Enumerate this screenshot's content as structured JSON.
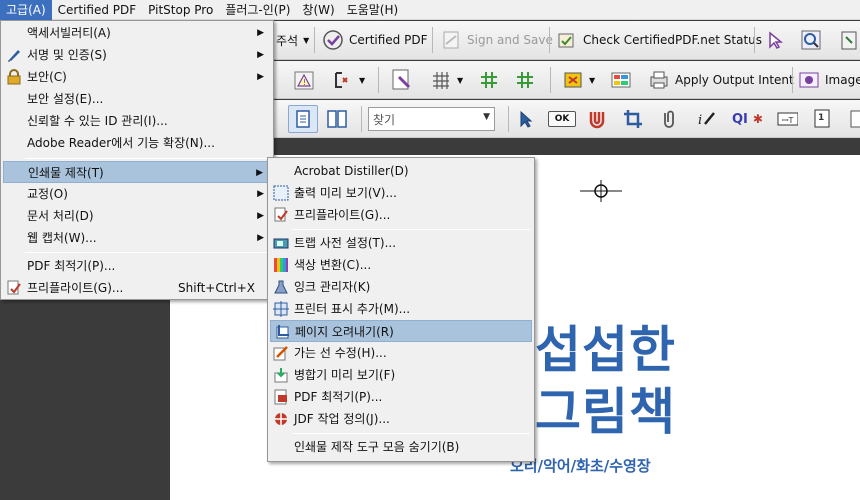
{
  "menubar": {
    "items": [
      "고급(A)",
      "Certified PDF",
      "PitStop Pro",
      "플러그-인(P)",
      "창(W)",
      "도움말(H)"
    ]
  },
  "toolbar1": {
    "partial_label": "주석",
    "certified_pdf": "Certified PDF",
    "sign_and_save": "Sign and Save",
    "check_status": "Check CertifiedPDF.net Status"
  },
  "toolbar2": {
    "apply_output_intent": "Apply Output Intent",
    "image": "Image"
  },
  "toolbar3": {
    "find_placeholder": "찾기",
    "ok_label": "OK",
    "qi_label": "QI"
  },
  "document": {
    "title_line1": "섭섭한",
    "title_line2": "그림책",
    "subtitle": "오리/악어/화초/수영장"
  },
  "menu_advanced": {
    "items": [
      {
        "label": "액세서빌러티(A)",
        "submenu": true
      },
      {
        "label": "서명 및 인증(S)",
        "submenu": true,
        "icon": "pen-icon"
      },
      {
        "label": "보안(C)",
        "submenu": true,
        "icon": "lock-icon"
      },
      {
        "label": "보안 설정(E)..."
      },
      {
        "label": "신뢰할 수 있는 ID 관리(I)..."
      },
      {
        "label": "Adobe Reader에서 기능 확장(N)..."
      },
      {
        "label": "인쇄물 제작(T)",
        "submenu": true,
        "highlighted": true
      },
      {
        "label": "교정(O)",
        "submenu": true
      },
      {
        "label": "문서 처리(D)",
        "submenu": true
      },
      {
        "label": "웹 캡처(W)...",
        "submenu": true
      },
      {
        "label": "PDF 최적기(P)..."
      },
      {
        "label": "프리플라이트(G)...",
        "shortcut": "Shift+Ctrl+X",
        "icon": "preflight-icon"
      }
    ]
  },
  "menu_print_production": {
    "items": [
      {
        "label": "Acrobat Distiller(D)"
      },
      {
        "label": "출력 미리 보기(V)...",
        "icon": "output-preview-icon"
      },
      {
        "label": "프리플라이트(G)...",
        "icon": "preflight-icon"
      },
      {
        "label": "트랩 사전 설정(T)...",
        "icon": "trap-presets-icon"
      },
      {
        "label": "색상 변환(C)...",
        "icon": "convert-colors-icon"
      },
      {
        "label": "잉크 관리자(K)",
        "icon": "ink-manager-icon"
      },
      {
        "label": "프린터 표시 추가(M)...",
        "icon": "printer-marks-icon"
      },
      {
        "label": "페이지 오려내기(R)",
        "icon": "crop-pages-icon",
        "highlighted": true
      },
      {
        "label": "가는 선 수정(H)...",
        "icon": "fix-hairlines-icon"
      },
      {
        "label": "병합기 미리 보기(F)",
        "icon": "flattener-preview-icon"
      },
      {
        "label": "PDF 최적기(P)...",
        "icon": "pdf-optimizer-icon"
      },
      {
        "label": "JDF 작업 정의(J)...",
        "icon": "jdf-icon"
      },
      {
        "label": "인쇄물 제작 도구 모음 숨기기(B)"
      }
    ]
  },
  "colors": {
    "menubar_active": "#3c6fbe",
    "menu_highlight": "#a9c3dc",
    "doc_title": "#2f64ae"
  }
}
